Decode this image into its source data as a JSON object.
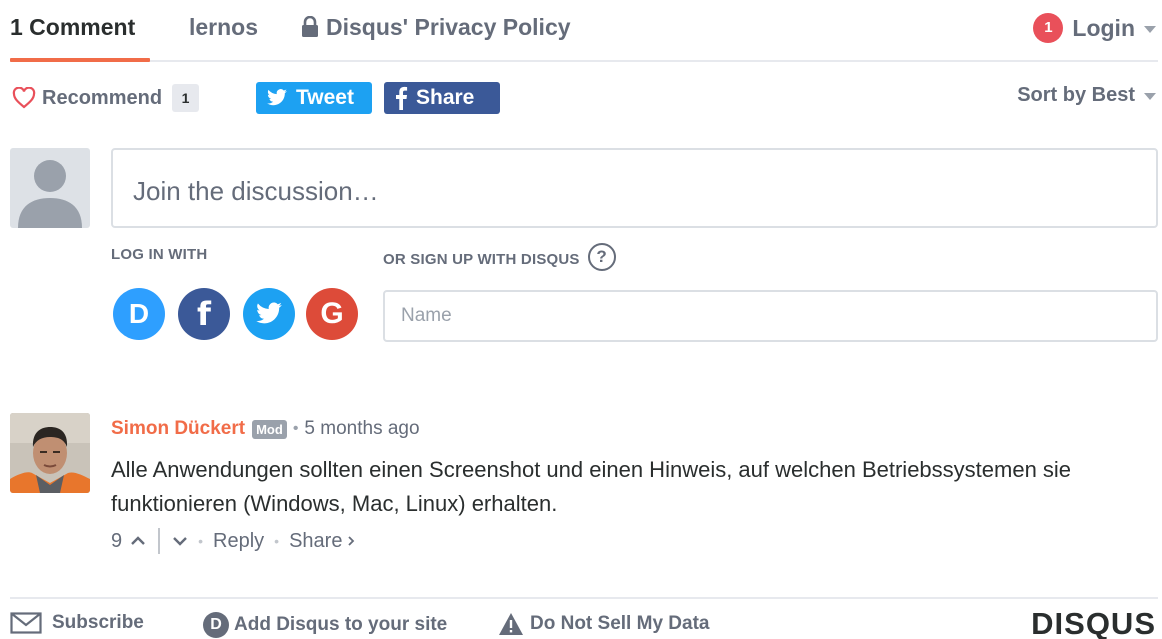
{
  "nav": {
    "comment_count": "1 Comment",
    "forum_name": "lernos",
    "privacy_label": "Disqus' Privacy Policy",
    "notification_count": "1",
    "login_label": "Login"
  },
  "actions": {
    "recommend_label": "Recommend",
    "recommend_count": "1",
    "tweet_label": "Tweet",
    "share_label": "Share",
    "sort_label": "Sort by Best"
  },
  "composer": {
    "placeholder": "Join the discussion…",
    "log_in_with_label": "LOG IN WITH",
    "sign_up_label": "OR SIGN UP WITH DISQUS",
    "help_symbol": "?",
    "name_placeholder": "Name",
    "social_providers": [
      {
        "name": "disqus",
        "glyph": "D",
        "color": "#2e9fff"
      },
      {
        "name": "facebook",
        "glyph": "f",
        "color": "#3b5998"
      },
      {
        "name": "twitter",
        "glyph": "",
        "color": "#1da1f2"
      },
      {
        "name": "google",
        "glyph": "G",
        "color": "#dd4b39"
      }
    ]
  },
  "comment": {
    "author": "Simon Dückert",
    "badge": "Mod",
    "time": "5 months ago",
    "body": "Alle Anwendungen sollten einen Screenshot und einen Hinweis, auf welchen Betriebssystemen sie funktionieren (Windows, Mac, Linux) erhalten.",
    "votes": "9",
    "reply_label": "Reply",
    "share_label": "Share"
  },
  "footer": {
    "subscribe_label": "Subscribe",
    "add_disqus_label": "Add Disqus to your site",
    "dnsmd_label": "Do Not Sell My Data",
    "brand": "DISQUS",
    "disqus_glyph": "D"
  },
  "colors": {
    "accent": "#f16c48",
    "muted_text": "#656c7a",
    "primary_text": "#2a2e2e",
    "border": "#dbdfe4",
    "twitter": "#1da1f2",
    "facebook": "#3b5998",
    "notification": "#e9505a"
  }
}
